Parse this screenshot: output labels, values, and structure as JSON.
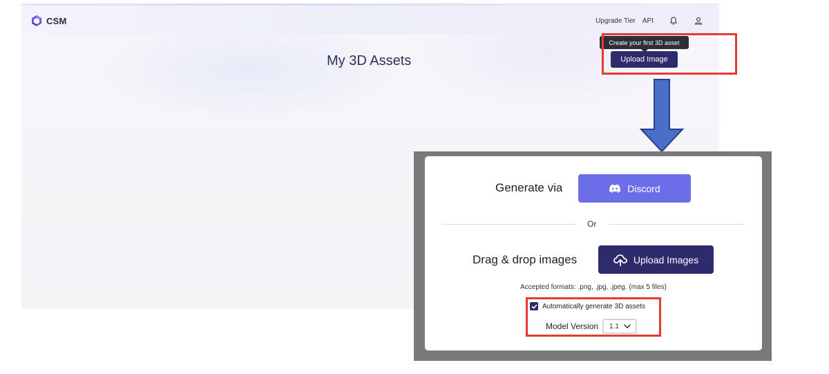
{
  "header": {
    "brand": "CSM",
    "nav": {
      "upgrade": "Upgrade Tier",
      "api": "API"
    }
  },
  "main": {
    "title": "My 3D Assets",
    "tooltip": "Create your first 3D asset",
    "upload_button": "Upload Image"
  },
  "modal": {
    "generate_via": "Generate via",
    "discord_button": "Discord",
    "or": "Or",
    "drag_drop": "Drag & drop images",
    "upload_images_button": "Upload Images",
    "accepted_formats": "Accepted formats: .png, .jpg, .jpeg. (max 5 files)",
    "auto_generate_label": "Automatically generate 3D assets",
    "auto_generate_checked": true,
    "model_version_label": "Model Version",
    "model_version_value": "1.1"
  },
  "colors": {
    "primary": "#2d2b6b",
    "discord": "#6c6de8",
    "highlight": "#e53a32",
    "arrow": "#4a6fc9"
  },
  "icons": [
    "logo-mark",
    "bell-icon",
    "user-icon",
    "discord-icon",
    "cloud-upload-icon",
    "check-icon",
    "chevron-down-icon",
    "down-arrow"
  ]
}
